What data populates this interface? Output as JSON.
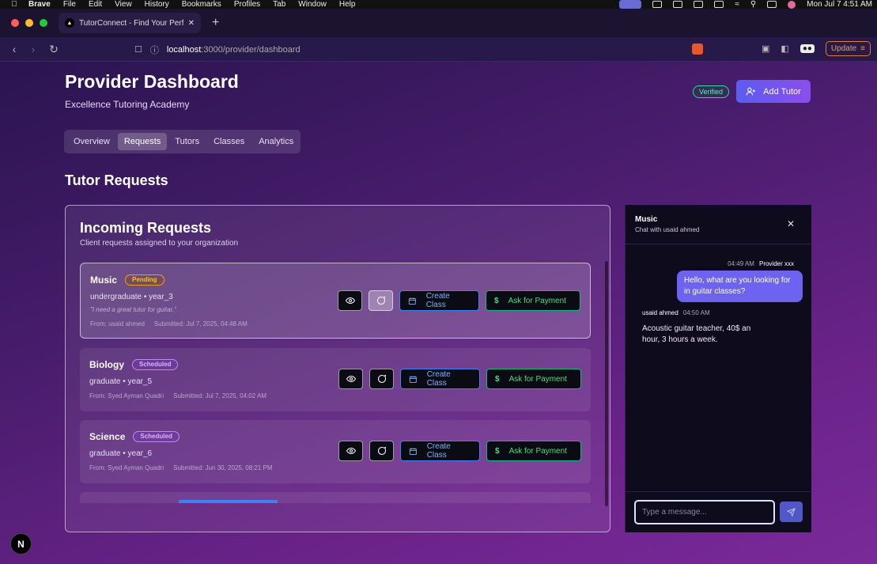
{
  "menubar": {
    "app": "Brave",
    "items": [
      "File",
      "Edit",
      "View",
      "History",
      "Bookmarks",
      "Profiles",
      "Tab",
      "Window",
      "Help"
    ],
    "clock": "Mon Jul 7  4:51 AM"
  },
  "browser": {
    "tab_title": "TutorConnect - Find Your Perfe",
    "url_host": "localhost",
    "url_path": ":3000/provider/dashboard",
    "update_label": "Update"
  },
  "header": {
    "title": "Provider Dashboard",
    "subtitle": "Excellence Tutoring Academy",
    "verified": "Verified",
    "add_tutor": "Add Tutor"
  },
  "tabs": [
    {
      "label": "Overview",
      "active": false
    },
    {
      "label": "Requests",
      "active": true
    },
    {
      "label": "Tutors",
      "active": false
    },
    {
      "label": "Classes",
      "active": false
    },
    {
      "label": "Analytics",
      "active": false
    }
  ],
  "section_title": "Tutor Requests",
  "requests_panel": {
    "title": "Incoming Requests",
    "subtitle": "Client requests assigned to your organization",
    "create_label": "Create Class",
    "pay_label": "Ask for Payment",
    "requests": [
      {
        "subject": "Music",
        "status": "Pending",
        "level": "undergraduate • year_3",
        "note": "\"I need a great tutor for guitar.\"",
        "from": "From: usaid ahmed",
        "submitted": "Submitted: Jul 7, 2025, 04:48 AM"
      },
      {
        "subject": "Biology",
        "status": "Scheduled",
        "level": "graduate • year_5",
        "from": "From: Syed Ayman Quadri",
        "submitted": "Submitted: Jul 7, 2025, 04:02 AM"
      },
      {
        "subject": "Science",
        "status": "Scheduled",
        "level": "graduate • year_6",
        "from": "From: Syed Ayman Quadri",
        "submitted": "Submitted: Jun 30, 2025, 08:21 PM"
      }
    ]
  },
  "chat": {
    "title": "Music",
    "subtitle": "Chat with usaid ahmed",
    "messages": [
      {
        "time": "04:49 AM",
        "sender": "Provider xxx",
        "text": "Hello, what are you looking for in guitar classes?"
      },
      {
        "time": "04:50 AM",
        "sender": "usaid ahmed",
        "text": "Acoustic guitar teacher, 40$ an hour, 3 hours a week."
      }
    ],
    "input_placeholder": "Type a message..."
  },
  "next_badge": "N"
}
